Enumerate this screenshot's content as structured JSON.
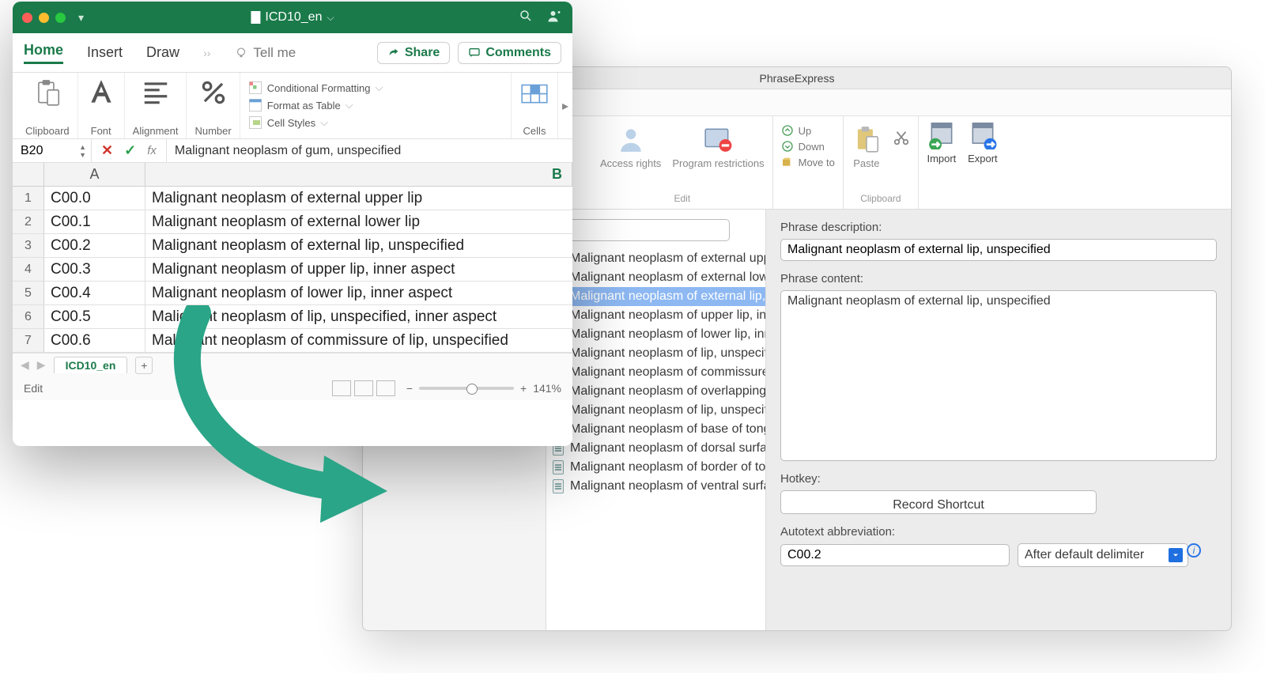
{
  "phraseexpress": {
    "title": "PhraseExpress",
    "toolbar": {
      "access": "Access rights",
      "program": "Program restrictions",
      "up": "Up",
      "down": "Down",
      "move": "Move to",
      "paste": "Paste",
      "import": "Import",
      "export": "Export",
      "grp_edit": "Edit",
      "grp_clip": "Clipboard"
    },
    "labels": {
      "desc": "Phrase description:",
      "content": "Phrase content:",
      "hotkey": "Hotkey:",
      "record": "Record Shortcut",
      "abbrev": "Autotext abbreviation:"
    },
    "values": {
      "desc": "Malignant neoplasm of external lip, unspecified",
      "content": "Malignant neoplasm of external lip, unspecified",
      "abbrev": "C00.2",
      "delimiter": "After default delimiter"
    },
    "list": [
      "Malignant neoplasm of external upper lip",
      "Malignant neoplasm of external lower lip",
      "Malignant neoplasm of external lip, unspecified",
      "Malignant neoplasm of upper lip, inner aspect",
      "Malignant neoplasm of lower lip, inner aspect",
      "Malignant neoplasm of lip, unspecified, inner aspect",
      "Malignant neoplasm of commissure of lip, unspecified",
      "Malignant neoplasm of overlapping sites of lip",
      "Malignant neoplasm of lip, unspecified",
      "Malignant neoplasm of base of tongue",
      "Malignant neoplasm of dorsal surface of tongue",
      "Malignant neoplasm of border of tongue",
      "Malignant neoplasm of ventral surface of tongue"
    ],
    "selected_index": 2
  },
  "excel": {
    "filename": "ICD10_en",
    "tabs": {
      "home": "Home",
      "insert": "Insert",
      "draw": "Draw",
      "tellme": "Tell me"
    },
    "actions": {
      "share": "Share",
      "comments": "Comments"
    },
    "ribbon": {
      "clipboard": "Clipboard",
      "font": "Font",
      "alignment": "Alignment",
      "number": "Number",
      "cond": "Conditional Formatting",
      "table": "Format as Table",
      "styles": "Cell Styles",
      "cells": "Cells"
    },
    "fx": {
      "namebox": "B20",
      "formula": "Malignant neoplasm of gum, unspecified"
    },
    "cols": {
      "a": "A",
      "b": "B"
    },
    "rows": [
      {
        "n": "1",
        "a": "C00.0",
        "b": "Malignant neoplasm of external upper lip"
      },
      {
        "n": "2",
        "a": "C00.1",
        "b": "Malignant neoplasm of external lower lip"
      },
      {
        "n": "3",
        "a": "C00.2",
        "b": "Malignant neoplasm of external lip, unspecified"
      },
      {
        "n": "4",
        "a": "C00.3",
        "b": "Malignant neoplasm of upper lip, inner aspect"
      },
      {
        "n": "5",
        "a": "C00.4",
        "b": "Malignant neoplasm of lower lip, inner aspect"
      },
      {
        "n": "6",
        "a": "C00.5",
        "b": "Malignant neoplasm of lip, unspecified, inner aspect"
      },
      {
        "n": "7",
        "a": "C00.6",
        "b": "Malignant neoplasm of commissure of lip, unspecified"
      }
    ],
    "sheet_tab": "ICD10_en",
    "status": {
      "mode": "Edit",
      "zoom": "141%"
    }
  }
}
